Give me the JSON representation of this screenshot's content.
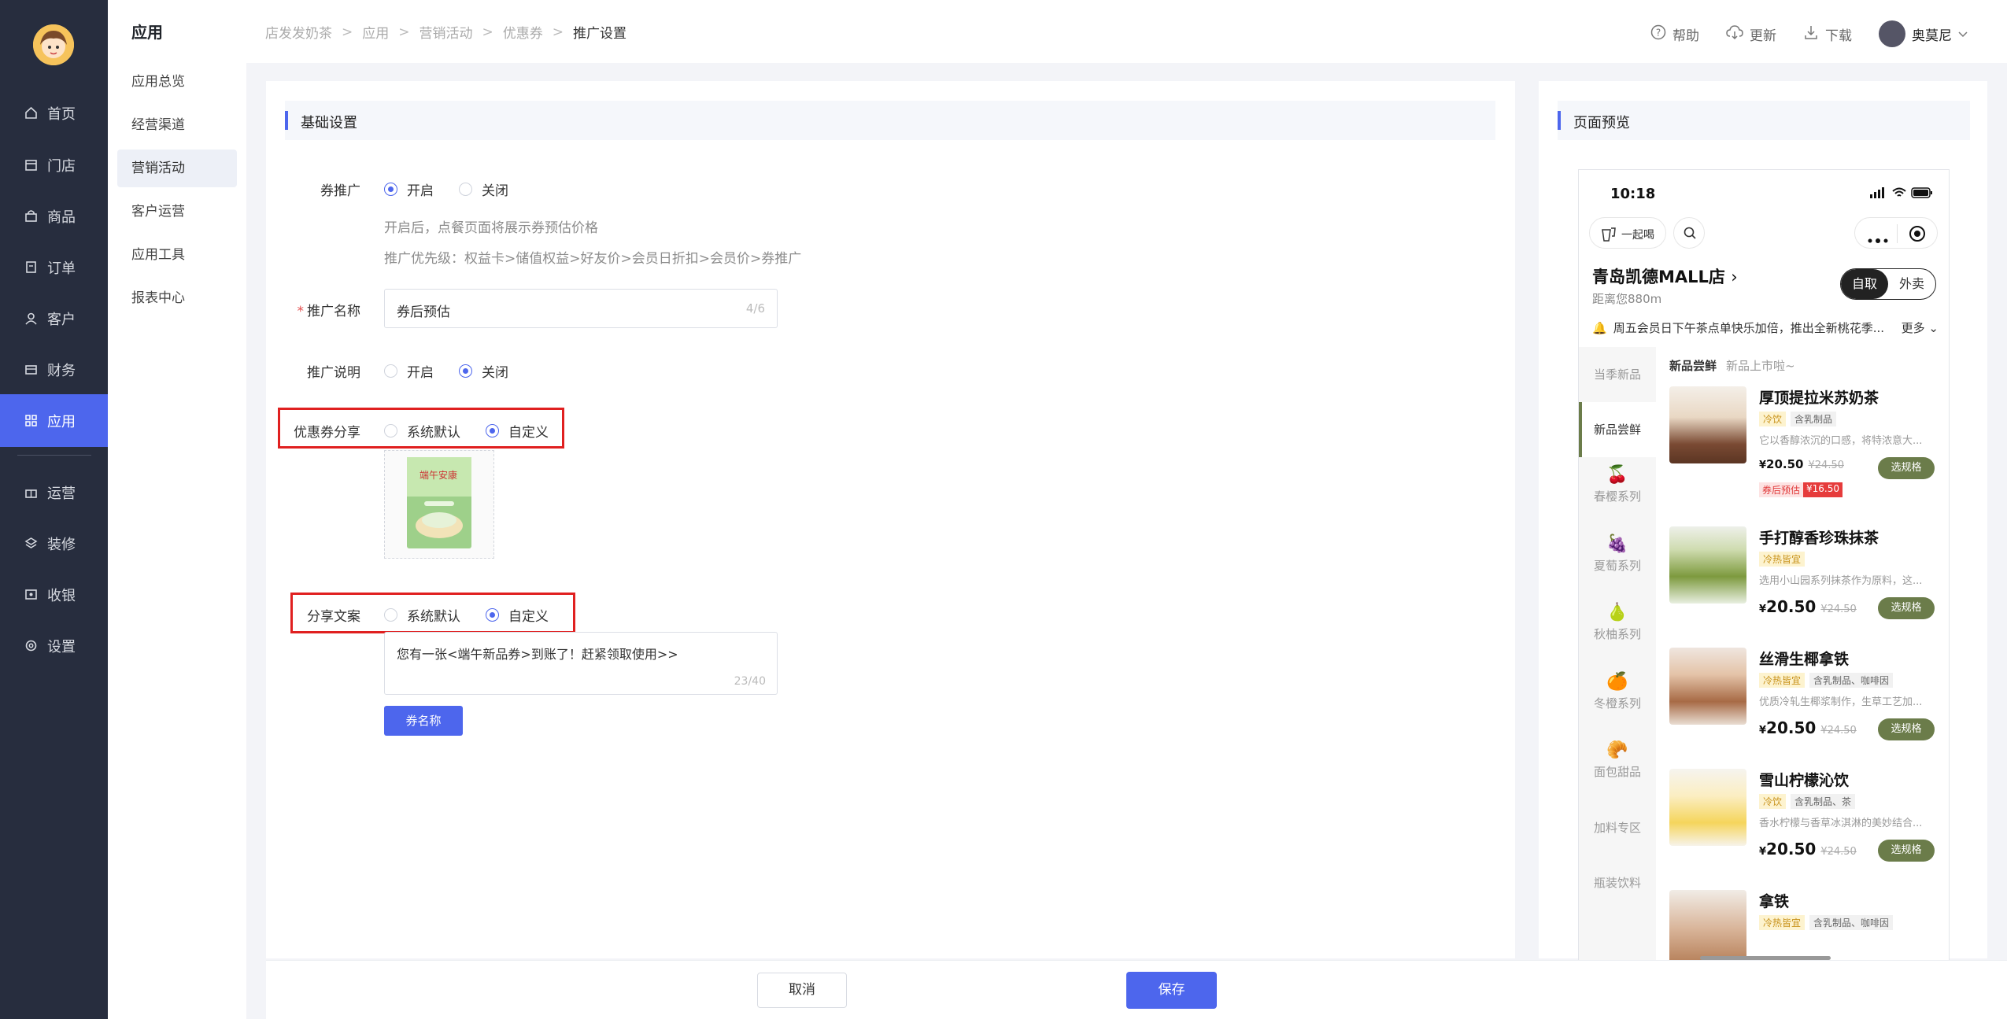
{
  "sidebar": {
    "items": [
      {
        "label": "首页"
      },
      {
        "label": "门店"
      },
      {
        "label": "商品"
      },
      {
        "label": "订单"
      },
      {
        "label": "客户"
      },
      {
        "label": "财务"
      },
      {
        "label": "应用"
      },
      {
        "label": "运营"
      },
      {
        "label": "装修"
      },
      {
        "label": "收银"
      },
      {
        "label": "设置"
      }
    ],
    "active": "应用"
  },
  "subnav": {
    "title": "应用",
    "items": [
      {
        "label": "应用总览"
      },
      {
        "label": "经营渠道"
      },
      {
        "label": "营销活动"
      },
      {
        "label": "客户运营"
      },
      {
        "label": "应用工具"
      },
      {
        "label": "报表中心"
      }
    ]
  },
  "breadcrumb": [
    "店发发奶茶",
    "应用",
    "营销活动",
    "优惠券",
    "推广设置"
  ],
  "topbar": {
    "help": "帮助",
    "update": "更新",
    "download": "下载",
    "user": "奥莫尼"
  },
  "form": {
    "section_title": "基础设置",
    "coupon_promo": {
      "label": "券推广",
      "opt_on": "开启",
      "opt_off": "关闭",
      "selected": "开启"
    },
    "hint1": "开启后，点餐页面将展示券预估价格",
    "hint2": "推广优先级：权益卡>储值权益>好友价>会员日折扣>会员价>券推广",
    "promo_name": {
      "label": "推广名称",
      "value": "券后预估",
      "counter": "4/6"
    },
    "promo_desc": {
      "label": "推广说明",
      "opt_on": "开启",
      "opt_off": "关闭",
      "selected": "关闭"
    },
    "coupon_share": {
      "label": "优惠券分享",
      "opt_default": "系统默认",
      "opt_custom": "自定义",
      "selected": "自定义"
    },
    "coupon_image_text": "端午安康",
    "share_text": {
      "label": "分享文案",
      "opt_default": "系统默认",
      "opt_custom": "自定义",
      "selected": "自定义",
      "value": "您有一张<端午新品券>到账了！赶紧领取使用>>",
      "counter": "23/40"
    },
    "coupon_name_button": "券名称"
  },
  "actions": {
    "cancel": "取消",
    "save": "保存"
  },
  "preview": {
    "title": "页面预览",
    "time": "10:18",
    "together": "一起喝",
    "store_name": "青岛凯德MALL店",
    "distance": "距离您880m",
    "toggle_pickup": "自取",
    "toggle_delivery": "外卖",
    "notice": "周五会员日下午茶点单快乐加倍，推出全新桃花季...",
    "more": "更多",
    "categories": [
      {
        "label": "当季新品",
        "emoji": ""
      },
      {
        "label": "新品尝鲜",
        "emoji": ""
      },
      {
        "label": "春樱系列",
        "emoji": "🍒"
      },
      {
        "label": "夏萄系列",
        "emoji": "🍇"
      },
      {
        "label": "秋柚系列",
        "emoji": "🍐"
      },
      {
        "label": "冬橙系列",
        "emoji": "🍊"
      },
      {
        "label": "面包甜品",
        "emoji": "🥐"
      },
      {
        "label": "加料专区",
        "emoji": ""
      },
      {
        "label": "瓶装饮料",
        "emoji": ""
      }
    ],
    "list_head": "新品尝鲜",
    "list_sub": "新品上市啦~",
    "products": [
      {
        "name": "厚顶提拉米苏奶茶",
        "tags": [
          "冷饮",
          "含乳制品"
        ],
        "desc": "它以香醇浓沉的口感，将特浓意大...",
        "price": "20.50",
        "old": "¥24.50",
        "coupon_label": "券后预估",
        "coupon_price": "¥16.50",
        "spec": "选规格"
      },
      {
        "name": "手打醇香珍珠抹茶",
        "tags": [
          "冷热皆宜"
        ],
        "desc": "选用小山园系列抹茶作为原料，这...",
        "price": "20.50",
        "old": "¥24.50",
        "spec": "选规格"
      },
      {
        "name": "丝滑生椰拿铁",
        "tags": [
          "冷热皆宜",
          "含乳制品、咖啡因"
        ],
        "desc": "优质冷轧生椰浆制作，生草工艺加...",
        "price": "20.50",
        "old": "¥24.50",
        "spec": "选规格"
      },
      {
        "name": "雪山柠檬沁饮",
        "tags": [
          "冷饮",
          "含乳制品、茶"
        ],
        "desc": "香水柠檬与香草冰淇淋的美妙结合...",
        "price": "20.50",
        "old": "¥24.50",
        "spec": "选规格"
      },
      {
        "name": "拿铁",
        "tags": [
          "冷热皆宜",
          "含乳制品、咖啡因"
        ],
        "desc": "",
        "price": "",
        "old": "",
        "spec": ""
      }
    ],
    "currency": "¥"
  }
}
